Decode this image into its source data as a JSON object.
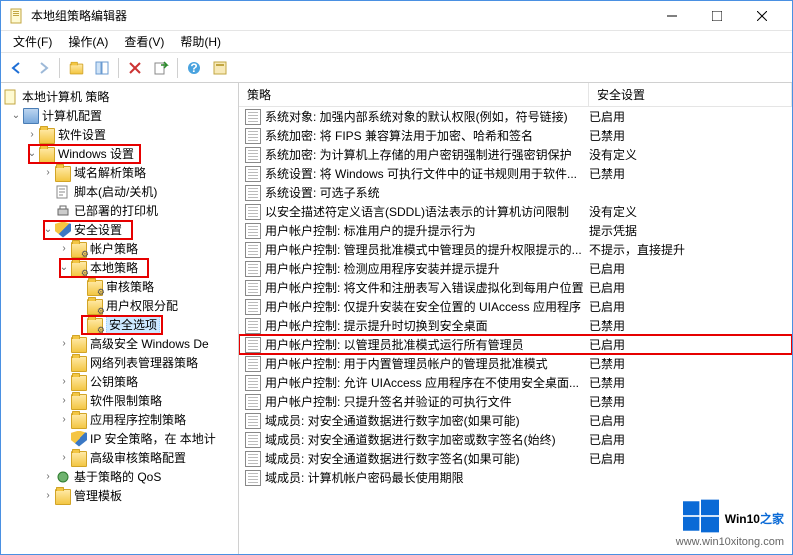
{
  "window": {
    "title": "本地组策略编辑器"
  },
  "menu": {
    "file": "文件(F)",
    "action": "操作(A)",
    "view": "查看(V)",
    "help": "帮助(H)"
  },
  "tree": {
    "root": "本地计算机 策略",
    "computer_config": "计算机配置",
    "software_settings": "软件设置",
    "windows_settings": "Windows 设置",
    "name_resolve": "域名解析策略",
    "scripts": "脚本(启动/关机)",
    "printers": "已部署的打印机",
    "security_settings": "安全设置",
    "account_policies": "帐户策略",
    "local_policies": "本地策略",
    "audit_policy": "审核策略",
    "user_rights": "用户权限分配",
    "security_options": "安全选项",
    "advanced_defender": "高级安全 Windows De",
    "network_list": "网络列表管理器策略",
    "public_key": "公钥策略",
    "software_restrict": "软件限制策略",
    "app_control": "应用程序控制策略",
    "ip_security": "IP 安全策略，在 本地计",
    "advanced_audit": "高级审核策略配置",
    "qos": "基于策略的 QoS",
    "admin_templates": "管理模板"
  },
  "columns": {
    "policy": "策略",
    "security_setting": "安全设置"
  },
  "policies": [
    {
      "name": "系统对象: 加强内部系统对象的默认权限(例如，符号链接)",
      "setting": "已启用"
    },
    {
      "name": "系统加密: 将 FIPS 兼容算法用于加密、哈希和签名",
      "setting": "已禁用"
    },
    {
      "name": "系统加密: 为计算机上存储的用户密钥强制进行强密钥保护",
      "setting": "没有定义"
    },
    {
      "name": "系统设置: 将 Windows 可执行文件中的证书规则用于软件...",
      "setting": "已禁用"
    },
    {
      "name": "系统设置: 可选子系统",
      "setting": ""
    },
    {
      "name": "以安全描述符定义语言(SDDL)语法表示的计算机访问限制",
      "setting": "没有定义"
    },
    {
      "name": "用户帐户控制: 标准用户的提升提示行为",
      "setting": "提示凭据"
    },
    {
      "name": "用户帐户控制: 管理员批准模式中管理员的提升权限提示的...",
      "setting": "不提示，直接提升"
    },
    {
      "name": "用户帐户控制: 检测应用程序安装并提示提升",
      "setting": "已启用"
    },
    {
      "name": "用户帐户控制: 将文件和注册表写入错误虚拟化到每用户位置",
      "setting": "已启用"
    },
    {
      "name": "用户帐户控制: 仅提升安装在安全位置的 UIAccess 应用程序",
      "setting": "已启用"
    },
    {
      "name": "用户帐户控制: 提示提升时切换到安全桌面",
      "setting": "已禁用"
    },
    {
      "name": "用户帐户控制: 以管理员批准模式运行所有管理员",
      "setting": "已启用",
      "highlight": true
    },
    {
      "name": "用户帐户控制: 用于内置管理员帐户的管理员批准模式",
      "setting": "已禁用"
    },
    {
      "name": "用户帐户控制: 允许 UIAccess 应用程序在不使用安全桌面...",
      "setting": "已禁用"
    },
    {
      "name": "用户帐户控制: 只提升签名并验证的可执行文件",
      "setting": "已禁用"
    },
    {
      "name": "域成员: 对安全通道数据进行数字加密(如果可能)",
      "setting": "已启用"
    },
    {
      "name": "域成员: 对安全通道数据进行数字加密或数字签名(始终)",
      "setting": "已启用"
    },
    {
      "name": "域成员: 对安全通道数据进行数字签名(如果可能)",
      "setting": "已启用"
    },
    {
      "name": "域成员: 计算机帐户密码最长使用期限",
      "setting": ""
    }
  ],
  "watermark": {
    "brand_en": "Win10",
    "brand_zh": "之家",
    "url": "www.win10xitong.com"
  }
}
